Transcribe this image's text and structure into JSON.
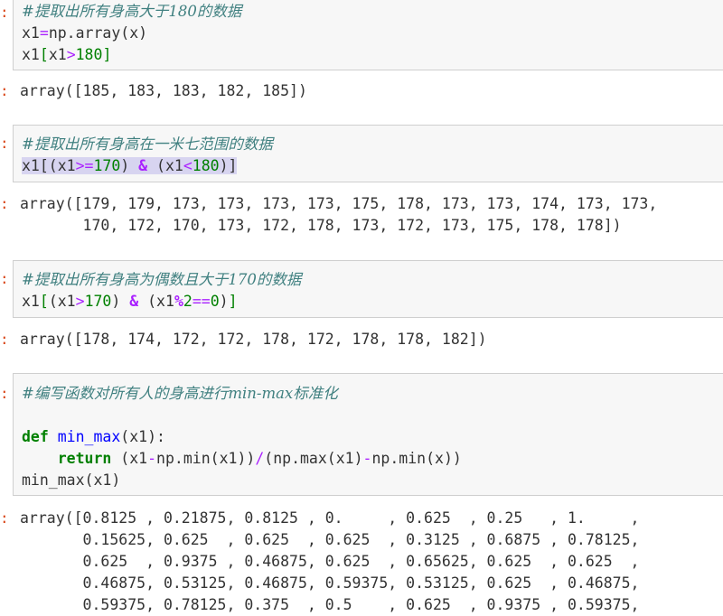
{
  "prompt_marker": ":",
  "cells": [
    {
      "comment": "#提取出所有身高大于180的数据",
      "line1": {
        "a": "x1",
        "eq": "=",
        "b": "np.array(x)"
      },
      "line2": {
        "a": "x1",
        "lb": "[",
        "b": "x1",
        "gt": ">",
        "n": "180",
        "rb": "]"
      },
      "output": [
        "array([185, 183, 183, 182, 185])"
      ]
    },
    {
      "comment": "#提取出所有身高在一米七范围的数据",
      "line1": {
        "a": "x1[(x1",
        "ge": ">=",
        "n1": "170",
        "b": ") ",
        "amp": "&",
        "c": " (x1",
        "lt": "<",
        "n2": "180",
        "d": ")]"
      },
      "output": [
        "array([179, 179, 173, 173, 173, 173, 175, 178, 173, 173, 174, 173, 173,",
        "       170, 172, 170, 173, 172, 178, 173, 172, 173, 175, 178, 178])"
      ]
    },
    {
      "comment": "#提取出所有身高为偶数且大于170的数据",
      "line1": {
        "a": "x1",
        "lb": "[",
        "b": "(x1",
        "gt": ">",
        "n1": "170",
        "c": ") ",
        "amp": "&",
        "d": " (x1",
        "mod": "%",
        "n2": "2",
        "eq": "==",
        "n3": "0",
        "e": ")",
        "rb": "]"
      },
      "output": [
        "array([178, 174, 172, 172, 178, 172, 178, 178, 182])"
      ]
    },
    {
      "comment": "#编写函数对所有人的身高进行min-max标准化",
      "def_kw": "def",
      "fn_name": "min_max",
      "def_rest": "(x1):",
      "ret_kw": "return",
      "ret_a": " (x1",
      "minus1": "-",
      "ret_b": "np.min(x1))",
      "slash": "/",
      "ret_c": "(np.max(x1)",
      "minus2": "-",
      "ret_d": "np.min(x))",
      "call": "min_max(x1)",
      "output": [
        "array([0.8125 , 0.21875, 0.8125 , 0.     , 0.625  , 0.25   , 1.     ,",
        "       0.15625, 0.625  , 0.625  , 0.625  , 0.3125 , 0.6875 , 0.78125,",
        "       0.625  , 0.9375 , 0.46875, 0.625  , 0.65625, 0.625  , 0.625  ,",
        "       0.46875, 0.53125, 0.46875, 0.59375, 0.53125, 0.625  , 0.46875,",
        "       0.59375, 0.78125, 0.375  , 0.5    , 0.625  , 0.9375 , 0.59375,"
      ]
    }
  ]
}
